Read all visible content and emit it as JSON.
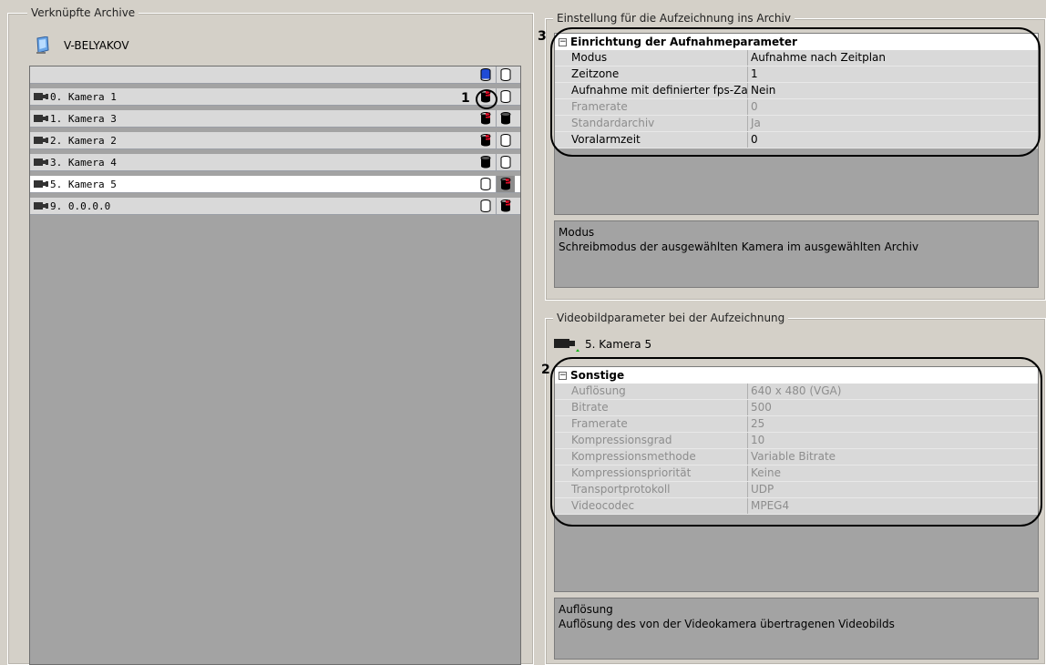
{
  "left_panel": {
    "title": "Verknüpfte Archive",
    "server_name": "V-BELYAKOV",
    "cameras": [
      {
        "label": "0. Kamera 1",
        "db1": "half-red",
        "db2": "empty",
        "selected": false
      },
      {
        "label": "1. Kamera 3",
        "db1": "half-red",
        "db2": "full",
        "selected": false
      },
      {
        "label": "2. Kamera 2",
        "db1": "half-red",
        "db2": "empty",
        "selected": false
      },
      {
        "label": "3. Kamera 4",
        "db1": "full",
        "db2": "empty",
        "selected": false
      },
      {
        "label": "5. Kamera 5",
        "db1": "empty",
        "db2": "half-red",
        "selected": true
      },
      {
        "label": "9. 0.0.0.0",
        "db1": "empty",
        "db2": "half-red",
        "selected": false
      }
    ]
  },
  "archive_settings": {
    "title": "Einstellung für die Aufzeichnung ins Archiv",
    "category": "Einrichtung der Aufnahmeparameter",
    "rows": [
      {
        "key": "Modus",
        "value": "Aufnahme nach Zeitplan",
        "disabled": false
      },
      {
        "key": "Zeitzone",
        "value": "1",
        "disabled": false
      },
      {
        "key": "Aufnahme mit definierter fps-Za",
        "value": "Nein",
        "disabled": false
      },
      {
        "key": "Framerate",
        "value": "0",
        "disabled": true
      },
      {
        "key": "Standardarchiv",
        "value": "Ja",
        "disabled": true
      },
      {
        "key": "Voralarmzeit",
        "value": "0",
        "disabled": false
      }
    ],
    "desc_title": "Modus",
    "desc_text": "Schreibmodus der ausgewählten Kamera im ausgewählten Archiv"
  },
  "video_settings": {
    "title": "Videobildparameter bei der Aufzeichnung",
    "camera_label": "5. Kamera 5",
    "category": "Sonstige",
    "rows": [
      {
        "key": "Auflösung",
        "value": "640 x 480 (VGA)",
        "disabled": true
      },
      {
        "key": "Bitrate",
        "value": "500",
        "disabled": true
      },
      {
        "key": "Framerate",
        "value": "25",
        "disabled": true
      },
      {
        "key": "Kompressionsgrad",
        "value": "10",
        "disabled": true
      },
      {
        "key": "Kompressionsmethode",
        "value": "Variable Bitrate",
        "disabled": true
      },
      {
        "key": "Kompressionspriorität",
        "value": "Keine",
        "disabled": true
      },
      {
        "key": "Transportprotokoll",
        "value": "UDP",
        "disabled": true
      },
      {
        "key": "Videocodec",
        "value": "MPEG4",
        "disabled": true
      }
    ],
    "desc_title": "Auflösung",
    "desc_text": "Auflösung des von der Videokamera übertragenen Videobilds"
  },
  "annotations": {
    "m1": "1",
    "m2": "2",
    "m3": "3"
  },
  "colors": {
    "db_blue": "#1f4bd6",
    "db_red": "#e0102a",
    "db_black": "#000000"
  }
}
